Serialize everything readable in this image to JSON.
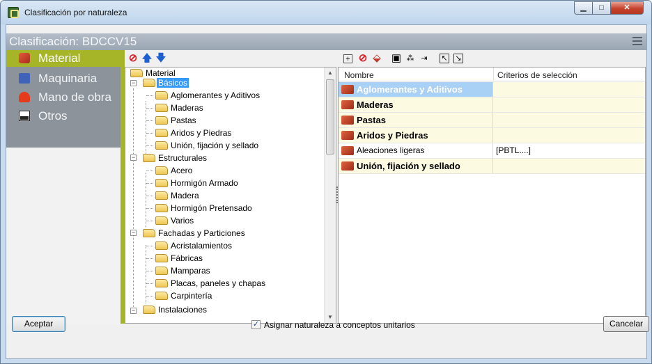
{
  "window": {
    "title": "Clasificación por naturaleza"
  },
  "header": {
    "title": "Clasificación: BDCCV15"
  },
  "categories": [
    {
      "label": "Material",
      "icon": "brick-icon",
      "active": true
    },
    {
      "label": "Maquinaria",
      "icon": "truck-icon",
      "active": false
    },
    {
      "label": "Mano de obra",
      "icon": "helmet-icon",
      "active": false
    },
    {
      "label": "Otros",
      "icon": "otros-icon",
      "active": false
    }
  ],
  "tree": {
    "nodes": [
      {
        "label": "Material"
      },
      {
        "label": "Básicos",
        "selected": true
      },
      {
        "label": "Aglomerantes y Aditivos"
      },
      {
        "label": "Maderas"
      },
      {
        "label": "Pastas"
      },
      {
        "label": "Aridos y Piedras"
      },
      {
        "label": "Unión, fijación y sellado"
      },
      {
        "label": "Estructurales"
      },
      {
        "label": "Acero"
      },
      {
        "label": "Hormigón Armado"
      },
      {
        "label": "Madera"
      },
      {
        "label": "Hormigón Pretensado"
      },
      {
        "label": "Varios"
      },
      {
        "label": "Fachadas y Particiones"
      },
      {
        "label": "Acristalamientos"
      },
      {
        "label": "Fábricas"
      },
      {
        "label": "Mamparas"
      },
      {
        "label": "Placas, paneles y chapas"
      },
      {
        "label": "Carpintería"
      },
      {
        "label": "Instalaciones"
      }
    ]
  },
  "grid": {
    "columns": [
      "Nombre",
      "Criterios de selección"
    ],
    "rows": [
      {
        "name": "Aglomerantes y Aditivos",
        "criteria": ""
      },
      {
        "name": "Maderas",
        "criteria": ""
      },
      {
        "name": "Pastas",
        "criteria": ""
      },
      {
        "name": "Aridos y Piedras",
        "criteria": ""
      },
      {
        "name": "Aleaciones ligeras",
        "criteria": "[PBTL....]"
      },
      {
        "name": "Unión, fijación y sellado",
        "criteria": ""
      }
    ]
  },
  "footer": {
    "accept_label": "Aceptar",
    "cancel_label": "Cancelar",
    "checkbox_label": "Asignar naturaleza a conceptos unitarios",
    "checkbox_checked": true
  },
  "colors": {
    "accent_green": "#a6b528",
    "selection_blue": "#3399ff"
  }
}
